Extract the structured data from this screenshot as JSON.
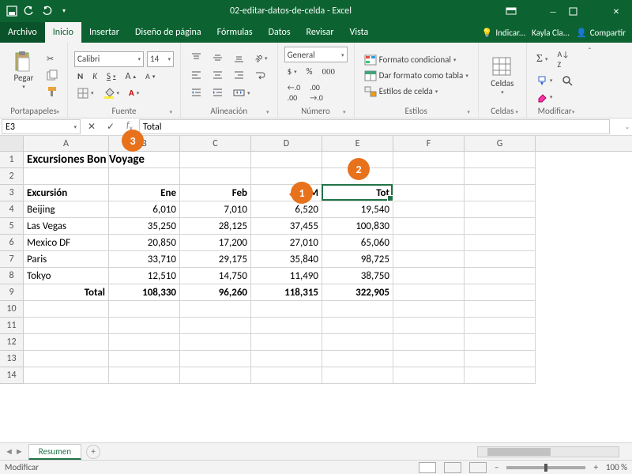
{
  "titlebar": {
    "doc": "02-editar-datos-de-celda",
    "app": "Excel"
  },
  "menu": {
    "file": "Archivo",
    "home": "Inicio",
    "insert": "Insertar",
    "layout": "Diseño de página",
    "formulas": "Fórmulas",
    "data": "Datos",
    "review": "Revisar",
    "view": "Vista",
    "tellme": "Indicar...",
    "user": "Kayla Cla...",
    "share": "Compartir"
  },
  "ribbon": {
    "clipboard": {
      "paste": "Pegar",
      "label": "Portapapeles"
    },
    "font": {
      "name": "Calibri",
      "size": "14",
      "bold": "N",
      "italic": "K",
      "underline": "S",
      "label": "Fuente"
    },
    "align": {
      "label": "Alineación"
    },
    "number": {
      "format": "General",
      "label": "Número"
    },
    "styles": {
      "cond": "Formato condicional",
      "table": "Dar formato como tabla",
      "cell": "Estilos de celda",
      "label": "Estilos"
    },
    "cells": {
      "label": "Celdas",
      "btn": "Celdas"
    },
    "edit": {
      "label": "Modificar"
    }
  },
  "namebox": "E3",
  "formula": "Total",
  "columns": [
    "A",
    "B",
    "C",
    "D",
    "E",
    "F",
    "G"
  ],
  "chart_data": {
    "type": "table",
    "title": "Excursiones Bon Voyage",
    "row_header": "Excursión",
    "col_headers": [
      "Ene",
      "Feb",
      "Mar",
      "Tot"
    ],
    "header_display": {
      "D": "M",
      "E": "Tot"
    },
    "rows_label": "Total",
    "data": [
      {
        "name": "Beijing",
        "Ene": 6010,
        "Feb": 7010,
        "Mar": 6520,
        "Tot": 19540
      },
      {
        "name": "Las Vegas",
        "Ene": 35250,
        "Feb": 28125,
        "Mar": 37455,
        "Tot": 100830
      },
      {
        "name": "Mexico DF",
        "Ene": 20850,
        "Feb": 17200,
        "Mar": 27010,
        "Tot": 65060
      },
      {
        "name": "Paris",
        "Ene": 33710,
        "Feb": 29175,
        "Mar": 35840,
        "Tot": 98725
      },
      {
        "name": "Tokyo",
        "Ene": 12510,
        "Feb": 14750,
        "Mar": 11490,
        "Tot": 38750
      }
    ],
    "totals": {
      "Ene": 108330,
      "Feb": 96260,
      "Mar": 118315,
      "Tot": 322905
    }
  },
  "display": {
    "r1": {
      "A": "Excursiones Bon Voyage"
    },
    "r3": {
      "A": "Excursión",
      "B": "Ene",
      "C": "Feb",
      "D": "M",
      "E": "Tot"
    },
    "r4": {
      "A": "Beijing",
      "B": "6,010",
      "C": "7,010",
      "D": "6,520",
      "E": "19,540"
    },
    "r5": {
      "A": "Las Vegas",
      "B": "35,250",
      "C": "28,125",
      "D": "37,455",
      "E": "100,830"
    },
    "r6": {
      "A": "Mexico DF",
      "B": "20,850",
      "C": "17,200",
      "D": "27,010",
      "E": "65,060"
    },
    "r7": {
      "A": "Paris",
      "B": "33,710",
      "C": "29,175",
      "D": "35,840",
      "E": "98,725"
    },
    "r8": {
      "A": "Tokyo",
      "B": "12,510",
      "C": "14,750",
      "D": "11,490",
      "E": "38,750"
    },
    "r9": {
      "A": "Total",
      "B": "108,330",
      "C": "96,260",
      "D": "118,315",
      "E": "322,905"
    }
  },
  "sheet": "Resumen",
  "status": {
    "mode": "Modificar",
    "zoom": "100 %"
  },
  "callouts": {
    "1": "1",
    "2": "2",
    "3": "3"
  }
}
